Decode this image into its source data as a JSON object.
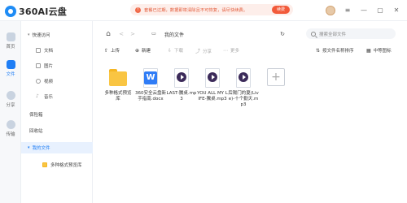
{
  "app": {
    "logo_text": "360AI云盘"
  },
  "notice": {
    "text": "套餐已过期，数据即将清除且不可恢复，请尽快续费。",
    "button": "续费"
  },
  "window": {
    "minimize": "—",
    "maximize": "▢",
    "close": "✕"
  },
  "rail": [
    {
      "label": "首页",
      "icon": "home-icon"
    },
    {
      "label": "文件",
      "icon": "folder-icon"
    },
    {
      "label": "分享",
      "icon": "share-icon"
    },
    {
      "label": "传输",
      "icon": "transfer-icon"
    }
  ],
  "sidebar": {
    "quick_access": "快速访问",
    "items": [
      {
        "label": "文档",
        "icon": "document-icon"
      },
      {
        "label": "图片",
        "icon": "image-icon"
      },
      {
        "label": "视频",
        "icon": "video-icon"
      },
      {
        "label": "音乐",
        "icon": "music-icon"
      }
    ],
    "safe": "保险箱",
    "recycle": "回收站",
    "my_files": "我的文件",
    "subfolder": "多种格式预览库"
  },
  "nav": {
    "home_glyph": "⌂",
    "back": "<",
    "forward": ">",
    "breadcrumb": "我的文件",
    "refresh": "↻",
    "search_placeholder": "搜索全部文件"
  },
  "toolbar": {
    "upload": "上传",
    "new": "新建",
    "download": "下载",
    "share": "分享",
    "more": "更多",
    "sort": "按文件名称排序",
    "view": "中等图标"
  },
  "files": [
    {
      "name": "多种格式预览库",
      "type": "folder"
    },
    {
      "name": "360安全云盘新手指南.docx",
      "type": "doc",
      "badge": "W"
    },
    {
      "name": "LAST-騰桌.mp3",
      "type": "music"
    },
    {
      "name": "YOU ALL MY LIFE-騰桌.mp3",
      "type": "music"
    },
    {
      "name": "后陽门的夏(Live)-十个勤天.mp3",
      "type": "music"
    },
    {
      "name": "",
      "type": "add"
    }
  ],
  "colors": {
    "accent": "#1f7ef5",
    "notice_bg": "#fdeeea",
    "notice_text": "#e35b3a",
    "folder": "#f9c543"
  }
}
